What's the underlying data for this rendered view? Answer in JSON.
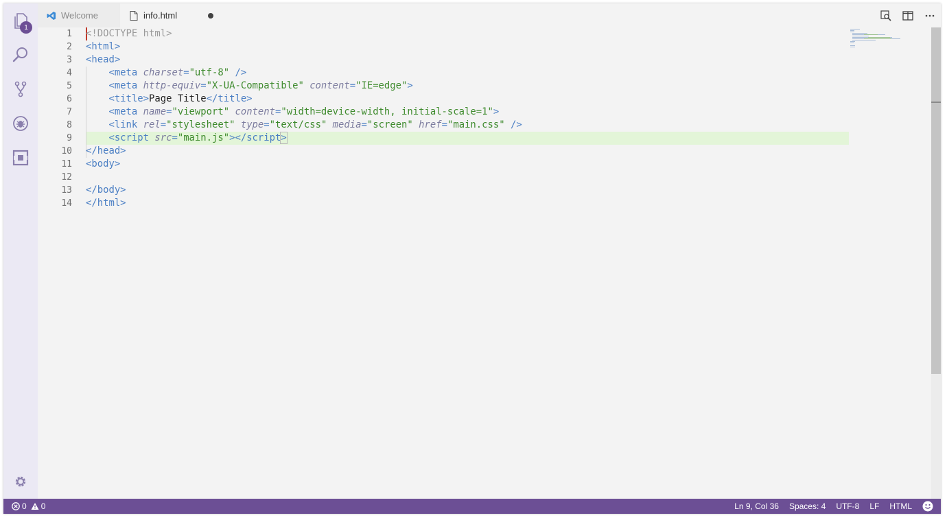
{
  "tabs": [
    {
      "label": "Welcome",
      "icon": "vscode-logo-icon",
      "active": false
    },
    {
      "label": "info.html",
      "icon": "file-icon",
      "active": true,
      "dirty": true
    }
  ],
  "activity_bar": {
    "explorer_badge": "1",
    "items": [
      "explorer",
      "search",
      "source-control",
      "debug",
      "extensions"
    ],
    "bottom": "settings"
  },
  "editor": {
    "line_numbers": [
      "1",
      "2",
      "3",
      "4",
      "5",
      "6",
      "7",
      "8",
      "9",
      "10",
      "11",
      "12",
      "13",
      "14"
    ],
    "current_line": 9
  },
  "status": {
    "errors": "0",
    "warnings": "0",
    "position": "Ln 9, Col 36",
    "indentation": "Spaces: 4",
    "encoding": "UTF-8",
    "eol": "LF",
    "language": "HTML"
  },
  "colors": {
    "accent": "#6c4f95",
    "current_line": "#e3f5d8",
    "tag": "#4b7fc4",
    "string": "#3f8b2e"
  }
}
